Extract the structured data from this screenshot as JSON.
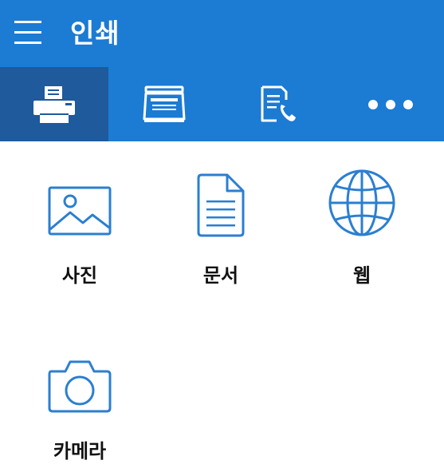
{
  "header": {
    "title": "인쇄",
    "menu_icon": "hamburger-menu-icon"
  },
  "tabs": [
    {
      "id": "print",
      "icon": "printer-icon",
      "active": true
    },
    {
      "id": "scan",
      "icon": "scanner-icon",
      "active": false
    },
    {
      "id": "fax",
      "icon": "fax-document-icon",
      "active": false
    },
    {
      "id": "more",
      "icon": "more-dots-icon",
      "active": false
    }
  ],
  "items": [
    {
      "label": "사진",
      "icon": "photo-icon"
    },
    {
      "label": "문서",
      "icon": "document-icon"
    },
    {
      "label": "웹",
      "icon": "globe-icon"
    },
    {
      "label": "카메라",
      "icon": "camera-icon"
    }
  ],
  "colors": {
    "header_bg": "#1c7bd3",
    "active_tab_bg": "#1e5a9c",
    "icon_blue": "#2b7fd0",
    "label_text": "#111111"
  }
}
